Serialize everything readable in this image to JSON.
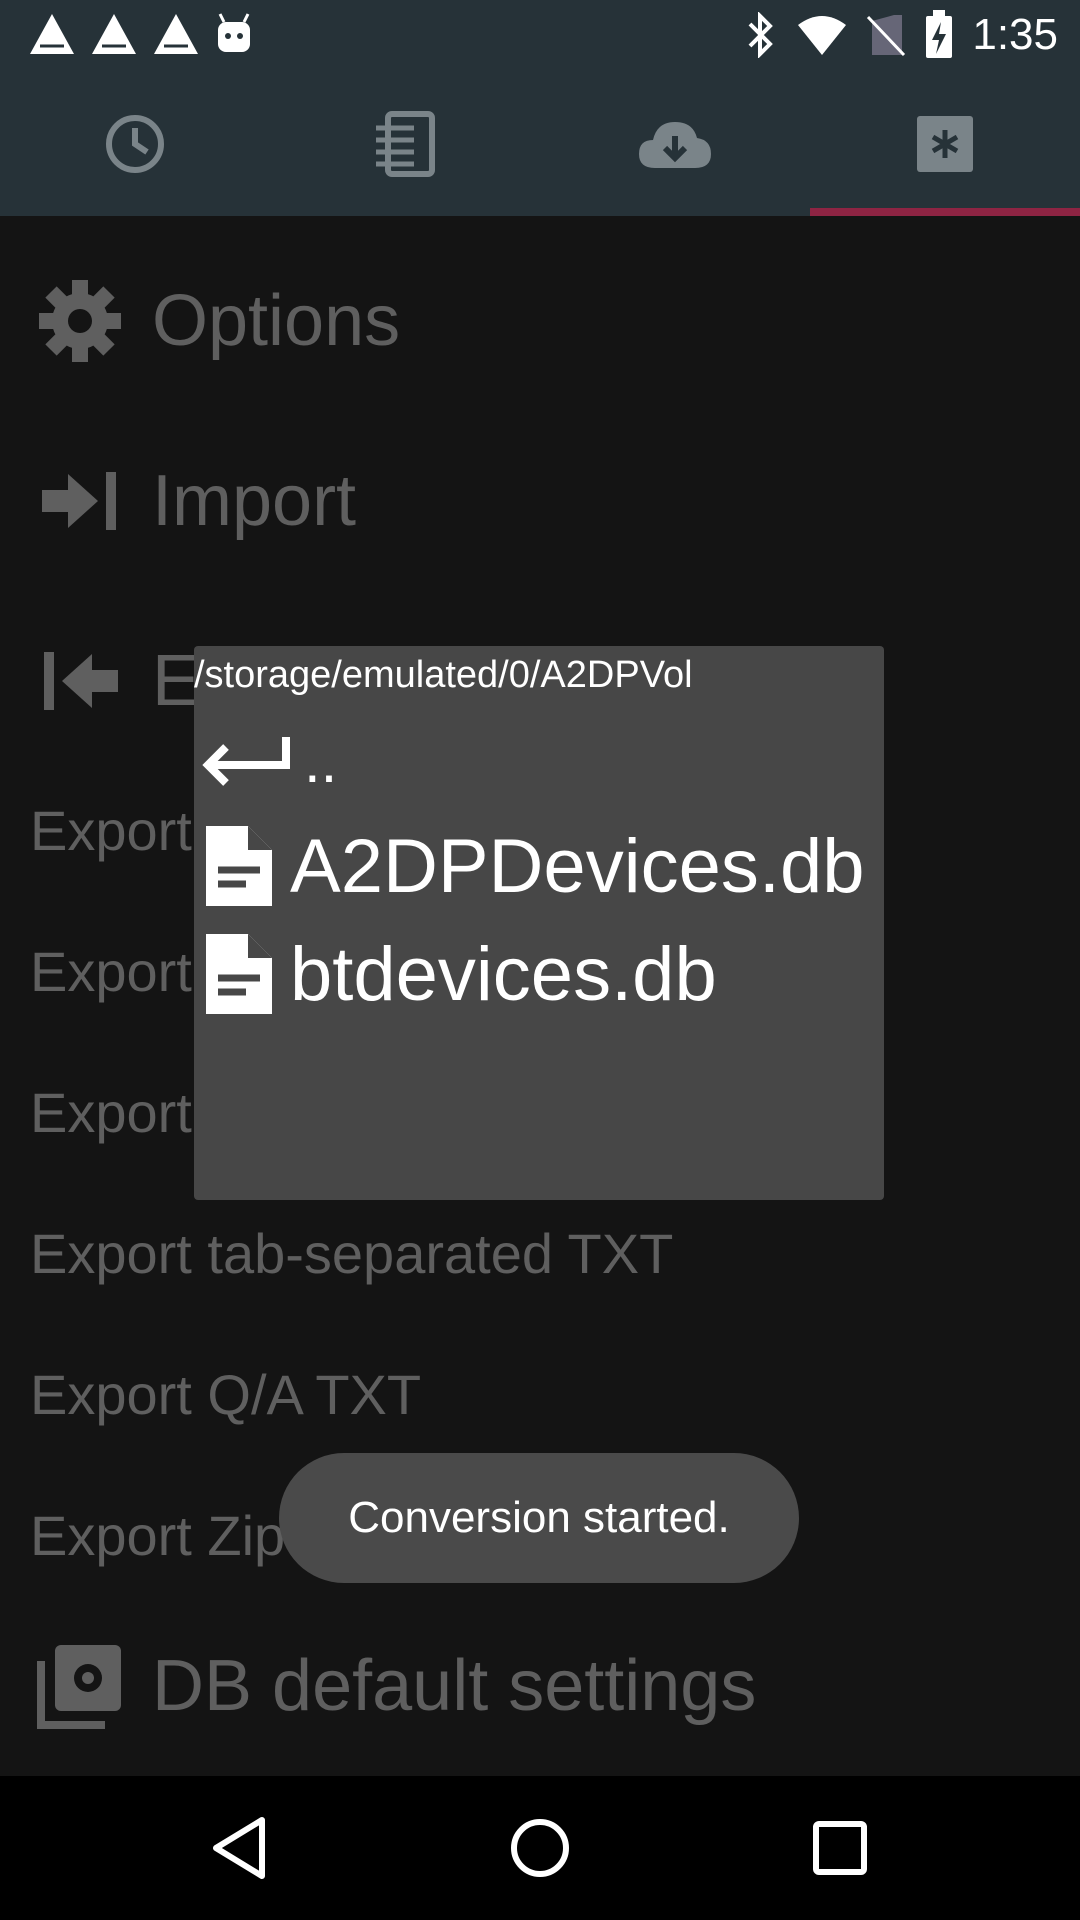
{
  "status_bar": {
    "time": "1:35",
    "left_icons": [
      "warning-triangle-icon",
      "warning-triangle-icon",
      "warning-triangle-icon",
      "android-debug-icon"
    ],
    "right_icons": [
      "bluetooth-icon",
      "wifi-icon",
      "no-sim-icon",
      "battery-charging-icon"
    ]
  },
  "tabs": [
    {
      "icon": "history-clock-icon",
      "selected": false
    },
    {
      "icon": "list-document-icon",
      "selected": false
    },
    {
      "icon": "cloud-download-icon",
      "selected": false
    },
    {
      "icon": "asterisk-box-icon",
      "selected": true
    }
  ],
  "menu": {
    "options": "Options",
    "import": "Import",
    "export_partial": "E",
    "export_rows": [
      "Export",
      "Export",
      "Export",
      "Export tab-separated TXT",
      "Export Q/A TXT",
      "Export Zip"
    ],
    "db_settings": "DB default settings"
  },
  "file_dialog": {
    "path": "/storage/emulated/0/A2DPVol",
    "parent": "..",
    "files": [
      "A2DPDevices.db",
      "btdevices.db"
    ]
  },
  "toast": "Conversion started.",
  "colors": {
    "bar": "#263238",
    "background": "#141414",
    "tab_indicator": "#8e2443",
    "dialog": "#474747",
    "dim_text": "#5f5f5f"
  }
}
